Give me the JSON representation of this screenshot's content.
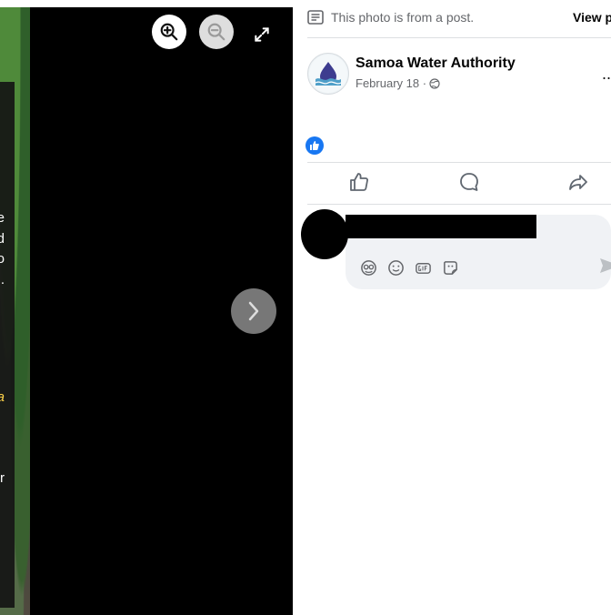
{
  "photo_viewer": {
    "caption_fragments": [
      "e",
      "d",
      "o",
      ".",
      "a",
      "r"
    ],
    "controls": {
      "zoom_in": "zoom-in-icon",
      "zoom_out": "zoom-out-icon",
      "fullscreen": "fullscreen-icon",
      "next": "next-photo-icon"
    }
  },
  "post_panel": {
    "notice": "This photo is from a post.",
    "view_post_label": "View p",
    "author": "Samoa Water Authority",
    "date": "February 18 · ",
    "audience_icon": "public-globe-icon",
    "more_label": "...",
    "reaction": "like-reaction-icon",
    "actions": [
      "like-icon",
      "comment-icon",
      "share-icon"
    ],
    "comment_tools": [
      "avatar-sticker-icon",
      "emoji-icon",
      "gif-icon",
      "sticker-icon"
    ],
    "send_icon": "send-icon"
  },
  "colors": {
    "accent": "#1877f2",
    "text": "#050505",
    "muted": "#65676b",
    "comment_bg": "#f0f2f5",
    "viewer_bg": "#000000"
  }
}
